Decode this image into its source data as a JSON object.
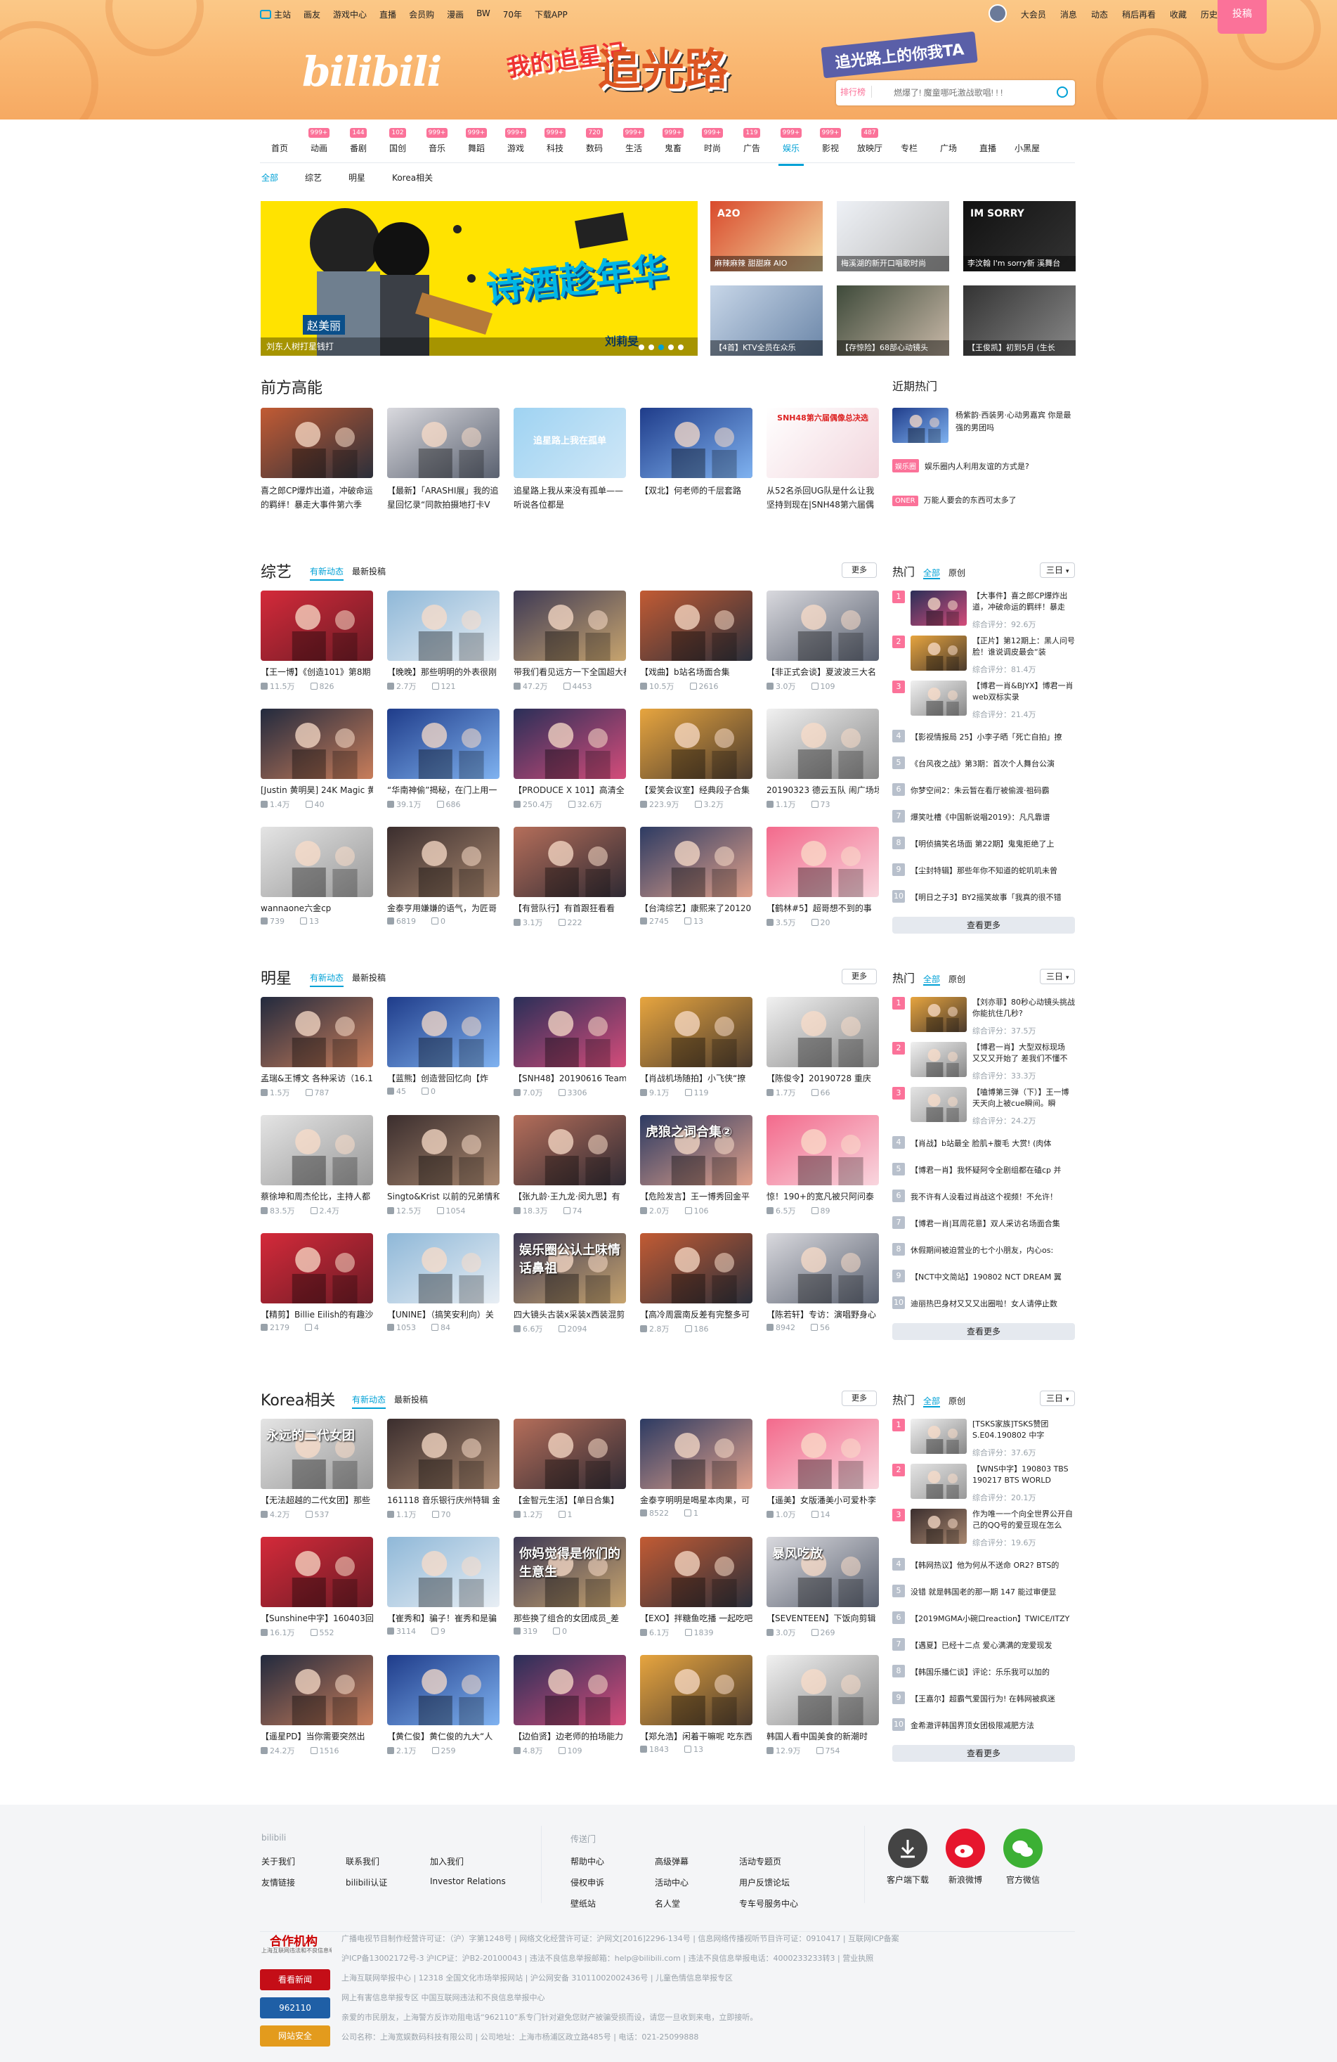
{
  "topnav": {
    "left": [
      "主站",
      "画友",
      "游戏中心",
      "直播",
      "会员购",
      "漫画",
      "BW",
      "70年",
      "下载APP"
    ],
    "right": [
      "大会员",
      "消息",
      "动态",
      "稍后再看",
      "收藏",
      "历史"
    ],
    "upload": "投稿"
  },
  "banner": {
    "logo": "bilibili",
    "title_small": "我的追星记",
    "title_big": "追光路",
    "badge": "追光路上的你我TA"
  },
  "search": {
    "rank_label": "排行榜",
    "placeholder": "燃爆了! 魔童哪吒激战歌唱! ! !"
  },
  "categories": [
    {
      "label": "首页",
      "num": ""
    },
    {
      "label": "动画",
      "num": "999+"
    },
    {
      "label": "番剧",
      "num": "144"
    },
    {
      "label": "国创",
      "num": "102"
    },
    {
      "label": "音乐",
      "num": "999+"
    },
    {
      "label": "舞蹈",
      "num": "999+"
    },
    {
      "label": "游戏",
      "num": "999+"
    },
    {
      "label": "科技",
      "num": "999+"
    },
    {
      "label": "数码",
      "num": "720"
    },
    {
      "label": "生活",
      "num": "999+"
    },
    {
      "label": "鬼畜",
      "num": "999+"
    },
    {
      "label": "时尚",
      "num": "999+"
    },
    {
      "label": "广告",
      "num": "119"
    },
    {
      "label": "娱乐",
      "num": "999+"
    },
    {
      "label": "影视",
      "num": "999+"
    },
    {
      "label": "放映厅",
      "num": "487"
    },
    {
      "label": "专栏",
      "num": ""
    },
    {
      "label": "广场",
      "num": ""
    },
    {
      "label": "直播",
      "num": ""
    },
    {
      "label": "小黑屋",
      "num": ""
    }
  ],
  "subnav": [
    "全部",
    "综艺",
    "明星",
    "Korea相关"
  ],
  "hero": {
    "caption": "刘东人树打星钱打",
    "title": "诗酒趁年华",
    "singer": "刘莉旻",
    "singer2": "赵美丽",
    "side": [
      "麻辣麻辣 甜甜麻 AIO",
      "梅溪湖的新开口唱歌时尚",
      "李汶翰 I'm sorry新 溪舞台",
      "【4首】KTV全员在众乐",
      "【存惊险】68部心动镜头",
      "【王俊凯】初到5月 (生长"
    ],
    "side_titles": [
      "A2O",
      "",
      "IM SORRY",
      "",
      "",
      ""
    ]
  },
  "qianfang": {
    "title": "前方高能",
    "cards": [
      "喜之郎CP爆炸出道，冲破命运的羁绊！暴走大事件第六季",
      "【最新】「ARASHI展」我的追星回忆录“同款拍摄地打卡V",
      "追星路上我从来没有孤单——听说各位都是",
      "【双北】何老师的千层套路",
      "从52名杀回UG队是什么让我坚持到现在|SNH48第六届偶像"
    ],
    "overlay": [
      "",
      "",
      "追星路上我在孤单",
      "",
      "SNH48第六届偶像总决选"
    ]
  },
  "recent": {
    "title": "近期热门",
    "items": [
      {
        "tag": "",
        "text": "杨紫韵·西装男·心动男嘉宾 你是最强的男团吗"
      },
      {
        "tag": "娱乐圈",
        "text": "娱乐圈内人利用友谊的方式是?"
      },
      {
        "tag": "ONER",
        "text": "万能人要会的东西可太多了"
      }
    ]
  },
  "zongyi": {
    "title": "综艺",
    "tab1": "有新动态",
    "tab2": "最新投稿",
    "more": "更多",
    "cards": [
      {
        "t": "【王一博】《创造101》第8期",
        "p": "11.5万",
        "d": "826"
      },
      {
        "t": "【晚晚】那些明明的外表很刚",
        "p": "2.7万",
        "d": "121"
      },
      {
        "t": "带我们看见远方一下全国超大都",
        "p": "47.2万",
        "d": "4453"
      },
      {
        "t": "【戏曲】b站名场面合集",
        "p": "10.5万",
        "d": "2616"
      },
      {
        "t": "【非正式会谈】夏波波三大名",
        "p": "3.0万",
        "d": "109"
      },
      {
        "t": "[Justin 黄明昊] 24K Magic 黄",
        "p": "1.4万",
        "d": "40"
      },
      {
        "t": "“华南神偷”揭秘，在门上用一",
        "p": "39.1万",
        "d": "686"
      },
      {
        "t": "【PRODUCE X 101】高清全",
        "p": "250.4万",
        "d": "32.6万"
      },
      {
        "t": "【爱笑会议室】经典段子合集",
        "p": "223.9万",
        "d": "3.2万"
      },
      {
        "t": "20190323 德云五队 闹广场场",
        "p": "1.1万",
        "d": "73"
      },
      {
        "t": "wannaone六金cp",
        "p": "739",
        "d": "13"
      },
      {
        "t": "金泰亨用嫌嫌的语气，为匠哥",
        "p": "6819",
        "d": "0"
      },
      {
        "t": "【有营队行】有首跟狂看看",
        "p": "3.1万",
        "d": "222"
      },
      {
        "t": "【台湾综艺】康熙来了20120",
        "p": "2745",
        "d": "13"
      },
      {
        "t": "【鹤林#5】超哥想不到的事",
        "p": "3.5万",
        "d": "20"
      }
    ],
    "rank_title": "热门",
    "rank_tab_all": "全部",
    "rank_tab_orig": "原创",
    "days": "三日",
    "top": [
      {
        "t": "【大事件】喜之郎CP爆炸出道，冲破命运的羁绊！暴走",
        "s": "综合评分：92.6万"
      },
      {
        "t": "【正片】第12期上：黑人问号脸！谁说调皮最会“装",
        "s": "综合评分：81.4万"
      },
      {
        "t": "【博君一肖&BJYX】博君一肖web双标实录",
        "s": "综合评分：21.4万"
      }
    ],
    "list": [
      "【影视情报局 25】小李子晒「死亡自拍」撩",
      "《台风夜之战》第3期：首次个人舞台公演",
      "你梦空间2：朱云暂在看厅被偷渡·祖码霸",
      "爆笑吐槽《中国新说唱2019》：凡凡靠谱",
      "【明侦搞笑名场面 第22期】鬼鬼拒绝了上",
      "【尘封特辑】那些年你不知道的蛇叽叽未曾",
      "【明日之子3】BY2摇笑故事「我真的很不错"
    ],
    "seemore": "查看更多"
  },
  "mingxing": {
    "title": "明星",
    "tab1": "有新动态",
    "tab2": "最新投稿",
    "more": "更多",
    "cards": [
      {
        "t": "孟瑞&王博文 各种采访（16.1",
        "p": "1.5万",
        "d": "787"
      },
      {
        "t": "【蓝熊】创造营回忆向【炸",
        "p": "45",
        "d": "0"
      },
      {
        "t": "【SNH48】20190616 Team",
        "p": "7.0万",
        "d": "3306"
      },
      {
        "t": "【肖战机场随拍】小飞侠“撩",
        "p": "9.1万",
        "d": "119"
      },
      {
        "t": "【陈俊令】20190728 重庆",
        "p": "1.7万",
        "d": "66"
      },
      {
        "t": "蔡徐坤和周杰伦比，主持人都",
        "p": "83.5万",
        "d": "2.4万"
      },
      {
        "t": "Singto&Krist 以前的兄弟情和",
        "p": "12.5万",
        "d": "1054"
      },
      {
        "t": "【张九龄·王九龙·闵九思】有",
        "p": "18.3万",
        "d": "74"
      },
      {
        "t": "【危险发言】王一博秀回金平",
        "p": "2.0万",
        "d": "106"
      },
      {
        "t": "惊！190+的宽凡被只阿问泰",
        "p": "6.5万",
        "d": "89"
      },
      {
        "t": "【精剪】Billie Eilish的有趣沙",
        "p": "2179",
        "d": "4"
      },
      {
        "t": "【UNINE】（搞笑安利向）关",
        "p": "1053",
        "d": "84"
      },
      {
        "t": "四大镜头古装x采装x西装混剪",
        "p": "6.6万",
        "d": "2094"
      },
      {
        "t": "【高冷周震南反差有完整多可",
        "p": "2.8万",
        "d": "186"
      },
      {
        "t": "【陈若轩】专访：演唱野身心",
        "p": "8942",
        "d": "56"
      }
    ],
    "overlays": [
      "",
      "",
      "",
      "",
      "",
      "",
      "",
      "",
      "虎狼之词合集②",
      "",
      "",
      "",
      "娱乐圈公认土味情话鼻祖",
      "",
      ""
    ],
    "rank_title": "热门",
    "rank_tab_all": "全部",
    "rank_tab_orig": "原创",
    "days": "三日",
    "top": [
      {
        "t": "【刘亦菲】80秒心动镜头挑战 你能抗住几秒?",
        "s": "综合评分：37.5万"
      },
      {
        "t": "【博君一肖】大型双标现场 又又又开始了 差我们不懂不",
        "s": "综合评分：33.3万"
      },
      {
        "t": "【嗑博第三弹（下）】王一博天天向上被cue瞬间。瞬",
        "s": "综合评分：24.2万"
      }
    ],
    "list": [
      "【肖战】b站最全 脸肌+腹毛 大赏! (肉体",
      "【博君一肖】我怀疑阿令全剧组都在磕cp 并",
      "我不许有人没看过肖战这个视频！不允许！",
      "【博君一肖|耳周花意】双人采访名场面合集",
      "休假期间被迫营业的七个小朋友，内心os:",
      "【NCT中文简站】190802 NCT DREAM 翼",
      "迪丽热巴身材又又又出圈啦！女人请停止数"
    ],
    "seemore": "查看更多"
  },
  "korea": {
    "title": "Korea相关",
    "tab1": "有新动态",
    "tab2": "最新投稿",
    "more": "更多",
    "cards": [
      {
        "t": "【无法超越的二代女团】那些",
        "p": "4.2万",
        "d": "537"
      },
      {
        "t": "161118 音乐银行庆州特辑 金",
        "p": "1.1万",
        "d": "70"
      },
      {
        "t": "【金智元生活】【单日合集】",
        "p": "1.2万",
        "d": "1"
      },
      {
        "t": "金泰亨明明是喝星本肉果，可",
        "p": "8522",
        "d": "1"
      },
      {
        "t": "【遥美】女版潘美小可爱朴李",
        "p": "1.0万",
        "d": "14"
      },
      {
        "t": "【Sunshine中字】160403回",
        "p": "16.1万",
        "d": "552"
      },
      {
        "t": "【崔秀和】骗子！崔秀和是骗",
        "p": "3114",
        "d": "9"
      },
      {
        "t": "那些换了组合的女团成员_差",
        "p": "319",
        "d": "0"
      },
      {
        "t": "【EXO】拌糖鱼吃播 一起吃吧",
        "p": "6.1万",
        "d": "1839"
      },
      {
        "t": "【SEVENTEEN】下饭向剪辑",
        "p": "3.0万",
        "d": "269"
      },
      {
        "t": "【遥星PD】当你需要突然出",
        "p": "24.2万",
        "d": "1516"
      },
      {
        "t": "【黄仁俊】黄仁俊的九大“人",
        "p": "2.1万",
        "d": "259"
      },
      {
        "t": "【边伯贤】边老师的拍场能力",
        "p": "4.8万",
        "d": "109"
      },
      {
        "t": "【郑允浩】闲着干嘛呢 吃东西",
        "p": "1843",
        "d": "13"
      },
      {
        "t": "韩国人看中国美食的新潮时",
        "p": "12.9万",
        "d": "754"
      }
    ],
    "overlays": [
      "永远的二代女团",
      "",
      "",
      "",
      "",
      "",
      "",
      "你妈觉得是你们的生意生",
      "",
      "暴风吃放",
      "",
      "",
      "",
      "",
      ""
    ],
    "rank_title": "热门",
    "rank_tab_all": "全部",
    "rank_tab_orig": "原创",
    "days": "三日",
    "top": [
      {
        "t": "[TSKS家族]TSKS赞团S.E04.190802 中字",
        "s": "综合评分：37.6万"
      },
      {
        "t": "【WNS中字】190803 TBS 190217 BTS WORLD",
        "s": "综合评分：20.1万"
      },
      {
        "t": "作为唯一一个向全世界公开自己的QQ号的爱豆现在怎么",
        "s": "综合评分：19.6万"
      }
    ],
    "list": [
      "【韩网热议】他为何从不送命 OR2? BTS的",
      "没错 就是韩国老的那一期 147 能过审便显",
      "【2019MGMA小碗口reaction】TWICE/ITZY",
      "【遇夏】已经十二点 爱心满满的宠爱现发",
      "【韩国乐播仁谈】评论：乐乐我可以加的",
      "【王嘉尔】超霸气爱国行为! 在韩网被疯迷",
      "金希澈评韩国界顶女团极限减肥方法"
    ],
    "seemore": "查看更多"
  },
  "footer": {
    "bilibili": {
      "head": "bilibili",
      "links": [
        [
          "关于我们",
          "联系我们",
          "加入我们"
        ],
        [
          "友情链接",
          "bilibili认证",
          "Investor Relations"
        ]
      ]
    },
    "chuan": {
      "head": "传送门",
      "links": [
        [
          "帮助中心",
          "高级弹幕",
          "活动专题页"
        ],
        [
          "侵权申诉",
          "活动中心",
          "用户反馈论坛"
        ],
        [
          "壁纸站",
          "名人堂",
          "专车号服务中心"
        ]
      ]
    },
    "apps": [
      "客户端下载",
      "新浪微博",
      "官方微信"
    ],
    "org_title": "合作机构",
    "org_sub": "上海互联网违法和不良信息举报中心",
    "badges": [
      "看看新闻",
      "962110",
      "网站安全"
    ],
    "legal": [
      "广播电视节目制作经营许可证：（沪）字第1248号 | 网络文化经营许可证：沪网文[2016]2296-134号 | 信息网络传播视听节目许可证：0910417 | 互联网ICP备案",
      "沪ICP备13002172号-3 沪ICP证：沪B2-20100043 | 违法不良信息举报邮箱：help@bilibili.com | 违法不良信息举报电话：4000233233转3 | 营业执照",
      "上海互联网举报中心 | 12318 全国文化市场举报网站 | 沪公网安备 31011002002436号 | 儿童色情信息举报专区",
      "网上有害信息举报专区 中国互联网违法和不良信息举报中心",
      "亲爱的市民朋友，上海警方反诈劝阻电话“962110”系专门针对避免您财产被骗受损而设，请您一旦收到来电，立即接听。",
      "公司名称：上海宽娱数码科技有限公司 | 公司地址：上海市杨浦区政立路485号 | 电话：021-25099888"
    ]
  },
  "colors": {
    "accent": "#00a1d6",
    "pink": "#fb7299",
    "banner": "#f9b56f"
  }
}
